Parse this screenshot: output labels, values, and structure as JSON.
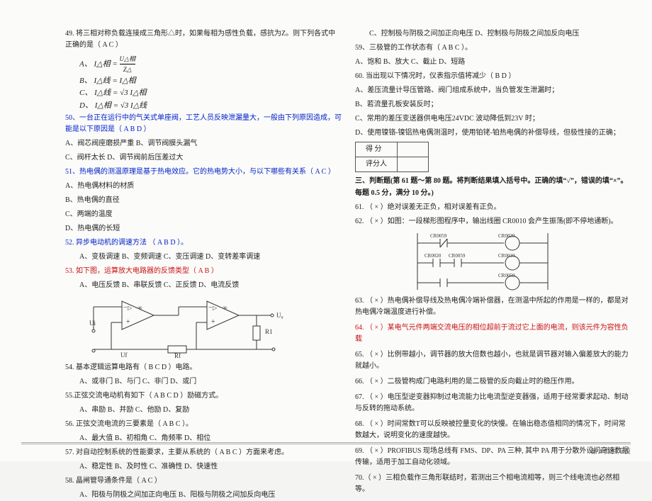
{
  "left": {
    "q49": "49.  将三相对称负载连接成三角形△时，如果每相为感性负载，感抗为Z。则下列各式中正确的是（  A  C  ）",
    "q49a": "A、",
    "q49b": "B、",
    "q49c": "C、",
    "q49d": "D、",
    "f_a_lhs": "I△相 =",
    "f_a_top": "U△相",
    "f_a_bot": "Z△",
    "f_b": "I△线 = I△相",
    "f_c": "I△线 = √3 I△相",
    "f_d": "I△相 = √3 I△线",
    "q50": "50、一台正在运行中的气关式单座阀，工艺人员反映泄漏量大，一般由下列原因造成，可能是以下原因是（  A B D  ）",
    "q50a": "A、阀芯阀座磨损严重      B、调节阀膜头漏气",
    "q50b": "C、阀杆太长              D、调节阀前后压差过大",
    "q51": "51、热电偶的测温原理是基于热电效应。它的热电势大小，与以下哪些有关系（   A  C      ）",
    "q51a": "A、热电偶材料的材质",
    "q51b": "B、热电偶的直径",
    "q51c": "C、两端的温度",
    "q51d": "D、热电偶的长短",
    "q52": "52. 异步电动机的调速方法   （   A  B  D   ）。",
    "q52a": "A、变极调速    B、变频调速    C、变压调速    D、变转差率调速",
    "q53": "53. 如下图，运算放大电路器的反馈类型（   A  B   ）",
    "q53a": "A、电压反馈    B、串联反馈    C、正反馈    D、电流反馈",
    "q54": "54. 基本逻辑运算电路有（  B  C  D  ）电路。",
    "q54a": "A、或非门  B、与门  C、非门  D、或门",
    "q55": "55.正弦交流电动机有如下（   A  B  C  D   ）励磁方式。",
    "q55a": "A、串励        B、并励        C、他励        D、复励",
    "q56": "56. 正弦交流电流的三要素是（   A  B  C   ）。",
    "q56a": "A、最大值  B、初相角  C、角频率  D、相位",
    "q57": "57. 对自动控制系统的性能要求，主要从系统的（   A  B  C   ）方面来考虑。",
    "q57a": "A、稳定性        B、及时性        C、准确性        D、快速性",
    "q58": "58. 晶闸管导通条件是（   A  C       ）",
    "q58a": "A、阳极与阴极之间加正向电压   B、阳极与阴极之间加反向电压",
    "diagram1_U0": "U₀",
    "diagram1_Ui": "Ui",
    "diagram1_Uf": "Uf",
    "diagram1_Rf": "Rf",
    "diagram1_R1": "R1",
    "diagram1_inf1": "∞",
    "diagram1_inf2": "∞"
  },
  "right": {
    "q58c": "C、控制极与阴极之间加正向电压  D、控制极与阴极之间加反向电压",
    "q59": "59、三极管的工作状态有（   A B C    ）。",
    "q59a": "A、饱和  B、放大  C、截止  D、短路",
    "q60": "60. 当出现以下情况时，仪表指示值将减少（     B    D      ）",
    "q60a": "A、差压流量计导压管路、阀门组成系统中，当负管发生泄漏时；",
    "q60b": "B、若流量孔板安装反时；",
    "q60c": "C、常用的差压变送器供电电压24VDC 波动降低到23V 时；",
    "q60d": "D、使用镍铬-镍铝热电偶测温时，使用铂铑-铂热电偶的补偿导线，但极性接的正确；",
    "score1": "得   分",
    "score2": "评分人",
    "section3": "三、判断题(第 61 题～第 80 题。将判断结果填入括号中。正确的填“√”，错误的填“×”。每题 0.5 分，满分 10 分。)",
    "q61": "61.  （  ×  ）绝对误差无正负，相对误差有正负。",
    "q62": "62.  （  ×  ）如图：一段梯形图程序中，输出线圈 CR0010 会产生振荡(即不停地通断)。",
    "d2_cr0059a": "CR0059",
    "d2_cr0020a": "CR0020",
    "d2_cr0020b": "CR0020",
    "d2_cr0059b": "CR0059",
    "d2_cr0010": "CR0010",
    "d2_cr0059c": "CR0059",
    "q63": "63.  （  ×  ）热电偶补偿导线及热电偶冷端补偿器，在测温中所起的作用是一样的，都是对热电偶冷端温度进行补偿。",
    "q64": "64.   （  ×  ）某电气元件两端交流电压的相位超前于流过它上面的电流，则该元件为容性负载",
    "q65": "65.  （  ×  ）比例带越小，调节器的放大倍数也越小，也就是调节器对输入偏差放大的能力就越小。",
    "q66": "66.  （  ×  ）二极管构成门电路利用的是二极管的反向截止时的稳压作用。",
    "q67": "67.  （  ×  ）电压型逆变器抑制过电流能力比电流型逆变器强，适用于经常要求起动、制动与反转的拖动系统。",
    "q68": "68.  （  ×  ）时间常数T可以反映被控量变化的快慢。在输出稳态值相同的情况下，时间常数越大，说明变化的速度越快。",
    "q69": "69. （ × ）PROFIBUS 现场总线有 FMS、DP、PA 三种, 其中 PA 用于分散外设问高速数据传输，适用于加工自动化领域。",
    "q70": "70.（ × ）三相负载作三角形联结时，若测出三个相电流相等，则三个线电流也必然相等。"
  },
  "footer": "第 4 页     共 6 页"
}
